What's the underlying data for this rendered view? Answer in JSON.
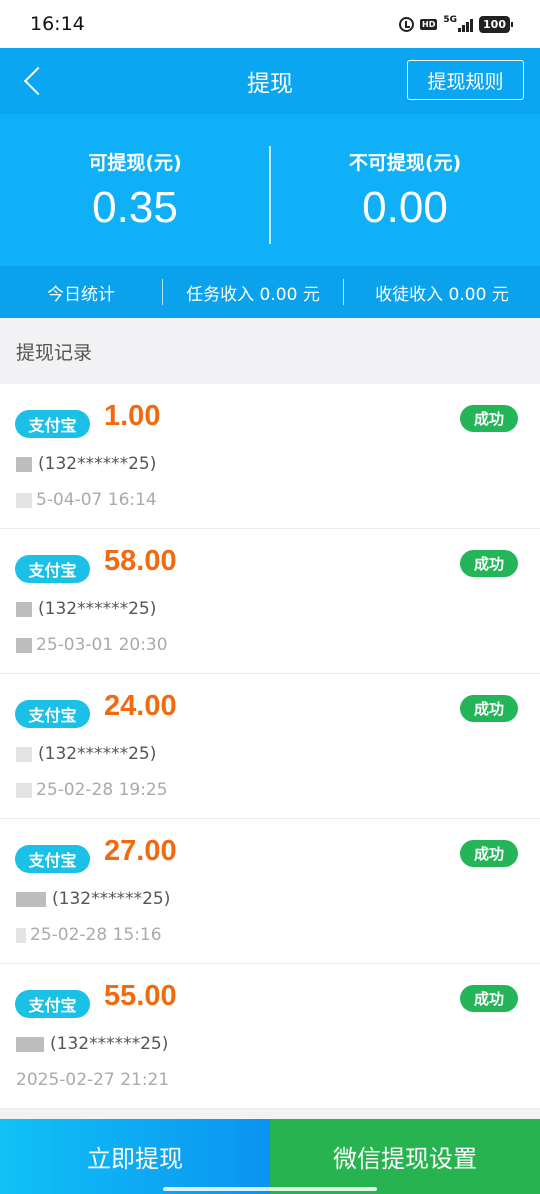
{
  "status_bar": {
    "time": "16:14",
    "hd": "HD",
    "network": "5G",
    "battery": "100"
  },
  "navbar": {
    "title": "提现",
    "rules_button": "提现规则"
  },
  "summary": {
    "withdrawable_label": "可提现(元)",
    "withdrawable_value": "0.35",
    "non_withdrawable_label": "不可提现(元)",
    "non_withdrawable_value": "0.00"
  },
  "stats": {
    "today_label": "今日统计",
    "task_income": "任务收入 0.00 元",
    "apprentice_income": "收徒收入 0.00 元"
  },
  "records_title": "提现记录",
  "records": [
    {
      "method": "支付宝",
      "amount": "1.00",
      "status": "成功",
      "account": "(132******25)",
      "time": "5-04-07 16:14"
    },
    {
      "method": "支付宝",
      "amount": "58.00",
      "status": "成功",
      "account": "(132******25)",
      "time": "25-03-01 20:30"
    },
    {
      "method": "支付宝",
      "amount": "24.00",
      "status": "成功",
      "account": "(132******25)",
      "time": "25-02-28 19:25"
    },
    {
      "method": "支付宝",
      "amount": "27.00",
      "status": "成功",
      "account": "(132******25)",
      "time": "25-02-28 15:16"
    },
    {
      "method": "支付宝",
      "amount": "55.00",
      "status": "成功",
      "account": "(132******25)",
      "time": "2025-02-27 21:21"
    }
  ],
  "bottom": {
    "withdraw_button": "立即提现",
    "wechat_button": "微信提现设置"
  },
  "colors": {
    "primary": "#0aa6f2",
    "amount": "#f26a0f",
    "success": "#24b559",
    "alipay_badge": "#1bc0e6",
    "wechat_button": "#27b34f"
  }
}
